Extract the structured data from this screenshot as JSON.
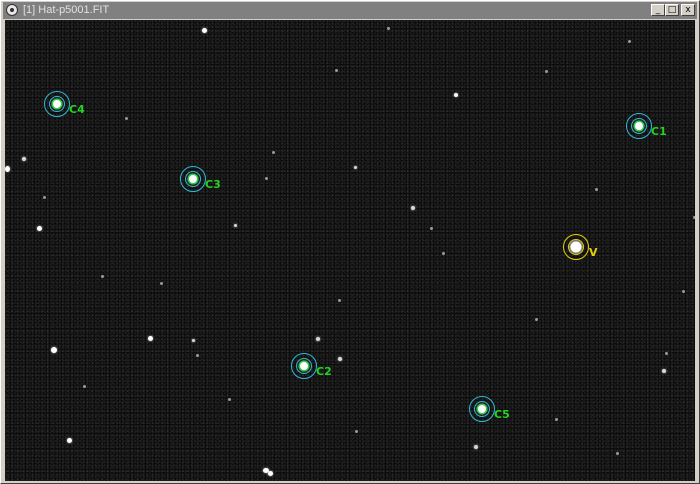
{
  "window": {
    "title": "[1] Hat-p5001.FIT",
    "controls": {
      "minimize": "_",
      "maximize": "□",
      "close": "x"
    }
  },
  "markers": {
    "v": {
      "label": "V",
      "color": "#e6d200"
    },
    "c1": {
      "label": "C1",
      "color": "#25d41f"
    },
    "c2": {
      "label": "C2",
      "color": "#25d41f"
    },
    "c3": {
      "label": "C3",
      "color": "#25d41f"
    },
    "c4": {
      "label": "C4",
      "color": "#25d41f"
    },
    "c5": {
      "label": "C5",
      "color": "#25d41f"
    }
  },
  "colors": {
    "aperture_ring": "#2fb8d8",
    "sky_background": "#0c0c0c",
    "titlebar_inactive": "#808080"
  }
}
